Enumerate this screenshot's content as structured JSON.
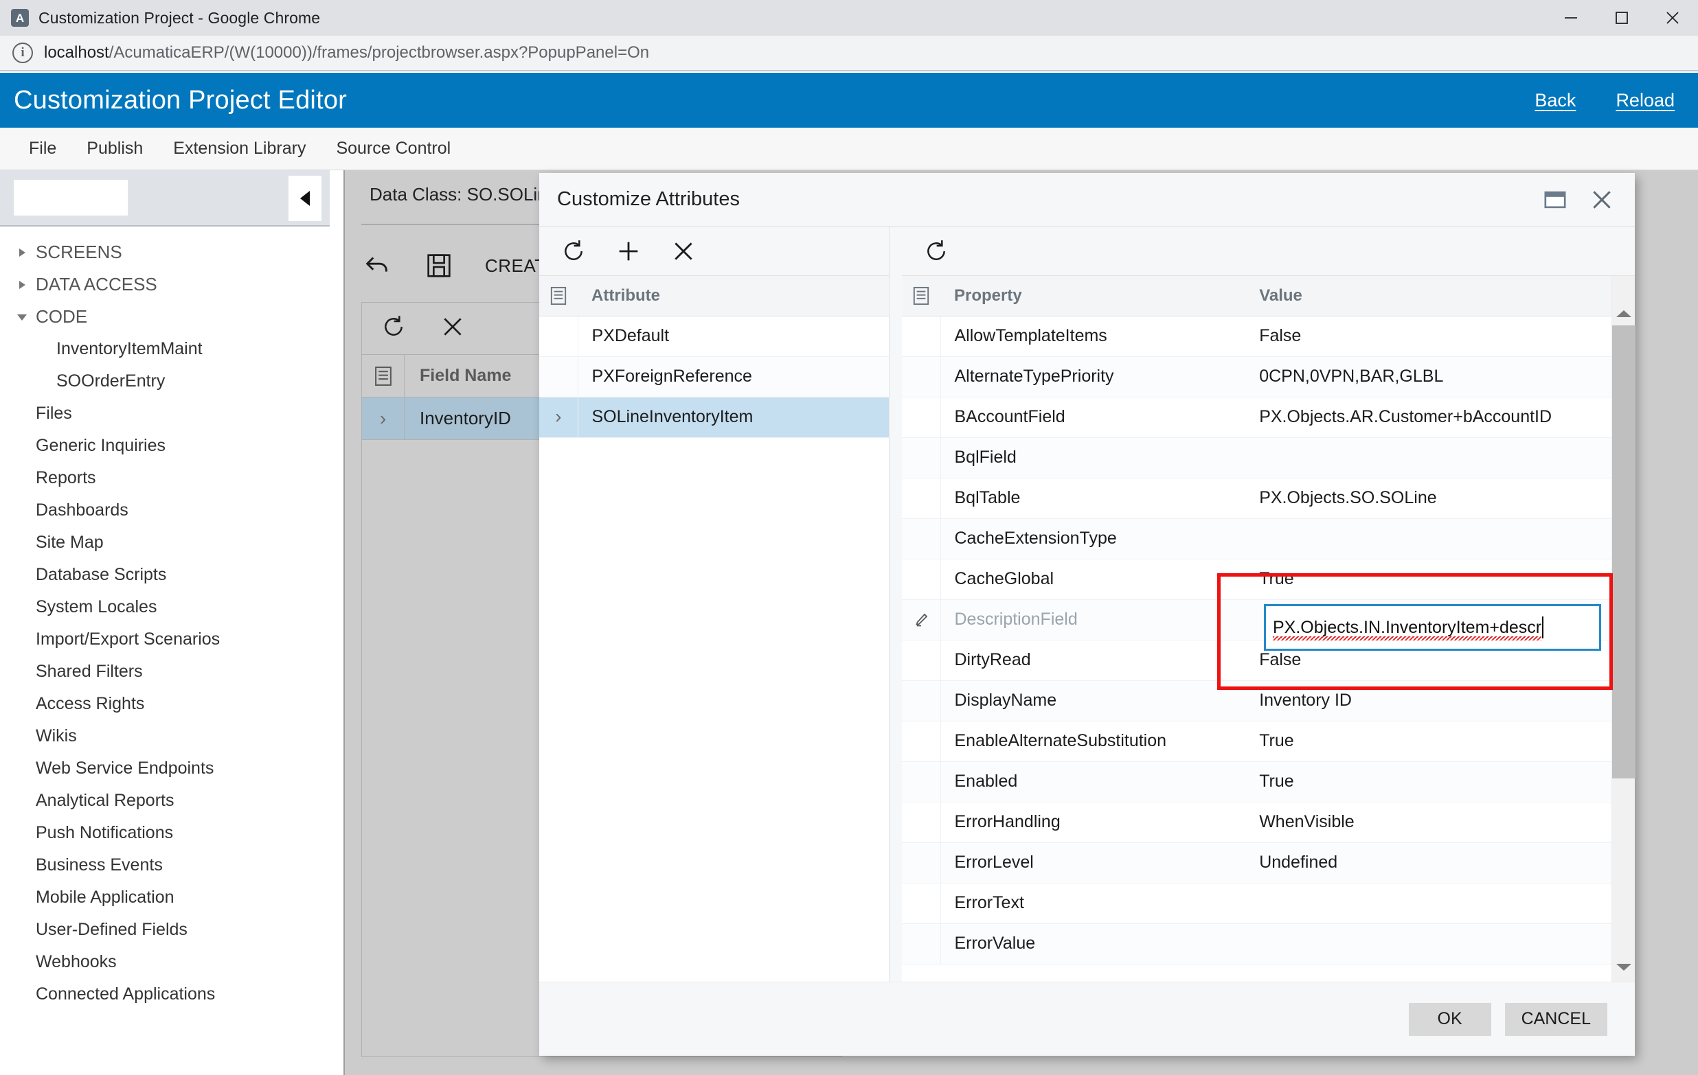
{
  "browser": {
    "window_title": "Customization Project - Google Chrome",
    "favicon": "acumatica-a-icon",
    "controls": {
      "minimize": "minimize-icon",
      "maximize": "maximize-icon",
      "close": "close-icon"
    },
    "address": {
      "info_icon": "page-info-icon",
      "host": "localhost",
      "path": "/AcumaticaERP/(W(10000))/frames/projectbrowser.aspx?PopupPanel=On"
    }
  },
  "app": {
    "title": "Customization Project Editor",
    "links": [
      {
        "label": "Back"
      },
      {
        "label": "Reload"
      }
    ],
    "accent_color": "#0277bd",
    "menu": [
      {
        "label": "File"
      },
      {
        "label": "Publish"
      },
      {
        "label": "Extension Library"
      },
      {
        "label": "Source Control"
      }
    ]
  },
  "sidebar": {
    "search_value": "",
    "search_placeholder": "",
    "collapse_icon": "collapse-left-icon",
    "items": [
      {
        "label": "SCREENS",
        "type": "group",
        "expanded": false
      },
      {
        "label": "DATA ACCESS",
        "type": "group",
        "expanded": false
      },
      {
        "label": "CODE",
        "type": "group",
        "expanded": true
      },
      {
        "label": "InventoryItemMaint",
        "type": "child"
      },
      {
        "label": "SOOrderEntry",
        "type": "child"
      },
      {
        "label": "Files",
        "type": "plain"
      },
      {
        "label": "Generic Inquiries",
        "type": "plain"
      },
      {
        "label": "Reports",
        "type": "plain"
      },
      {
        "label": "Dashboards",
        "type": "plain"
      },
      {
        "label": "Site Map",
        "type": "plain"
      },
      {
        "label": "Database Scripts",
        "type": "plain"
      },
      {
        "label": "System Locales",
        "type": "plain"
      },
      {
        "label": "Import/Export Scenarios",
        "type": "plain"
      },
      {
        "label": "Shared Filters",
        "type": "plain"
      },
      {
        "label": "Access Rights",
        "type": "plain"
      },
      {
        "label": "Wikis",
        "type": "plain"
      },
      {
        "label": "Web Service Endpoints",
        "type": "plain"
      },
      {
        "label": "Analytical Reports",
        "type": "plain"
      },
      {
        "label": "Push Notifications",
        "type": "plain"
      },
      {
        "label": "Business Events",
        "type": "plain"
      },
      {
        "label": "Mobile Application",
        "type": "plain"
      },
      {
        "label": "User-Defined Fields",
        "type": "plain"
      },
      {
        "label": "Webhooks",
        "type": "plain"
      },
      {
        "label": "Connected Applications",
        "type": "plain"
      }
    ]
  },
  "main": {
    "data_class_label": "Data Class: SO.SOLin",
    "toolbar": {
      "undo_icon": "undo-icon",
      "save_icon": "save-disk-icon",
      "create_label": "CREAT"
    },
    "grid": {
      "toolbar": {
        "refresh_icon": "refresh-icon",
        "delete_icon": "close-x-icon"
      },
      "header_icon": "grid-settings-icon",
      "column_header": "Field Name",
      "rows": [
        {
          "expander": "›",
          "name": "InventoryID",
          "selected": true
        }
      ]
    }
  },
  "modal": {
    "title": "Customize Attributes",
    "window_controls": {
      "restore": "restore-window-icon",
      "close": "close-icon"
    },
    "attribute_pane": {
      "toolbar": {
        "refresh_icon": "refresh-icon",
        "add_icon": "plus-icon",
        "delete_icon": "close-x-icon"
      },
      "header_icon": "grid-settings-icon",
      "column_header": "Attribute",
      "rows": [
        {
          "expander": "",
          "name": "PXDefault",
          "selected": false
        },
        {
          "expander": "",
          "name": "PXForeignReference",
          "selected": false
        },
        {
          "expander": "›",
          "name": "SOLineInventoryItem",
          "selected": true
        }
      ]
    },
    "property_pane": {
      "toolbar": {
        "refresh_icon": "refresh-icon"
      },
      "header_icon": "grid-settings-icon",
      "columns": [
        "Property",
        "Value"
      ],
      "rows": [
        {
          "gutter": "",
          "property": "AllowTemplateItems",
          "value": "False"
        },
        {
          "gutter": "",
          "property": "AlternateTypePriority",
          "value": "0CPN,0VPN,BAR,GLBL"
        },
        {
          "gutter": "",
          "property": "BAccountField",
          "value": "PX.Objects.AR.Customer+bAccountID"
        },
        {
          "gutter": "",
          "property": "BqlField",
          "value": ""
        },
        {
          "gutter": "",
          "property": "BqlTable",
          "value": "PX.Objects.SO.SOLine"
        },
        {
          "gutter": "",
          "property": "CacheExtensionType",
          "value": ""
        },
        {
          "gutter": "",
          "property": "CacheGlobal",
          "value": "True"
        },
        {
          "gutter": "pencil-icon",
          "property": "DescriptionField",
          "value": "",
          "editing": true
        },
        {
          "gutter": "",
          "property": "DirtyRead",
          "value": "False"
        },
        {
          "gutter": "",
          "property": "DisplayName",
          "value": "Inventory ID"
        },
        {
          "gutter": "",
          "property": "EnableAlternateSubstitution",
          "value": "True"
        },
        {
          "gutter": "",
          "property": "Enabled",
          "value": "True"
        },
        {
          "gutter": "",
          "property": "ErrorHandling",
          "value": "WhenVisible"
        },
        {
          "gutter": "",
          "property": "ErrorLevel",
          "value": "Undefined"
        },
        {
          "gutter": "",
          "property": "ErrorText",
          "value": ""
        },
        {
          "gutter": "",
          "property": "ErrorValue",
          "value": ""
        }
      ],
      "scrollbar": {
        "up_icon": "scroll-up-arrow",
        "down_icon": "scroll-down-arrow"
      }
    },
    "edit_field": {
      "value": "PX.Objects.IN.InventoryItem+descr",
      "has_spellcheck_underline": true,
      "border_color": "#2589c8"
    },
    "annotation": {
      "type": "highlight-box",
      "color": "#ee1111"
    },
    "footer": {
      "ok_label": "OK",
      "cancel_label": "CANCEL"
    }
  }
}
